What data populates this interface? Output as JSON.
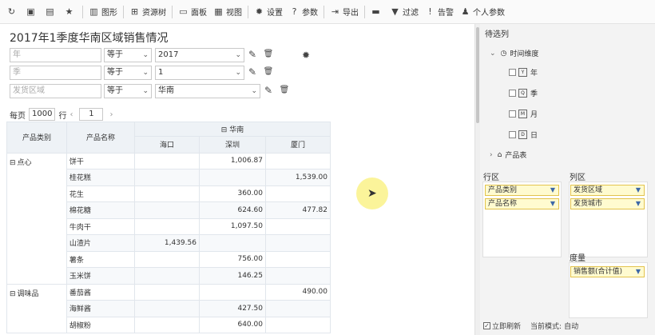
{
  "toolbar": {
    "items": [
      {
        "name": "refresh-button",
        "icon": "refresh-icon",
        "glyph": "↻",
        "label": ""
      },
      {
        "name": "save-button",
        "icon": "save-icon",
        "glyph": "▣",
        "label": ""
      },
      {
        "name": "save-as-button",
        "icon": "save-as-icon",
        "glyph": "▤",
        "label": ""
      },
      {
        "name": "favorite-button",
        "icon": "star-icon",
        "glyph": "★",
        "label": ""
      },
      {
        "name": "chart-button",
        "icon": "chart-icon",
        "glyph": "▥",
        "label": "图形"
      },
      {
        "name": "resource-tree-button",
        "icon": "resource-tree-icon",
        "glyph": "⊞",
        "label": "资源树"
      },
      {
        "name": "panel-button",
        "icon": "panel-icon",
        "glyph": "▭",
        "label": "面板"
      },
      {
        "name": "view-button",
        "icon": "view-icon",
        "glyph": "▦",
        "label": "视图"
      },
      {
        "name": "settings-button",
        "icon": "gear-icon",
        "glyph": "✹",
        "label": "设置"
      },
      {
        "name": "params-button",
        "icon": "help-icon",
        "glyph": "?",
        "label": "参数"
      },
      {
        "name": "export-button",
        "icon": "export-icon",
        "glyph": "⇥",
        "label": "导出"
      },
      {
        "name": "print-button",
        "icon": "print-icon",
        "glyph": "▬",
        "label": ""
      },
      {
        "name": "filter-button",
        "icon": "filter-icon",
        "glyph": "▼",
        "label": "过滤"
      },
      {
        "name": "alert-button",
        "icon": "alert-icon",
        "glyph": "!",
        "label": "告警"
      },
      {
        "name": "personal-params-button",
        "icon": "user-icon",
        "glyph": "♟",
        "label": "个人参数"
      }
    ]
  },
  "report": {
    "title": "2017年1季度华南区域销售情况"
  },
  "filters": [
    {
      "field": "年",
      "operator": "等于",
      "value": "2017"
    },
    {
      "field": "季",
      "operator": "等于",
      "value": "1"
    },
    {
      "field": "发货区域",
      "operator": "等于",
      "value": "华南"
    }
  ],
  "pager": {
    "per_page_label": "每页",
    "per_page_value": "1000",
    "row_label": "行",
    "prev": "‹",
    "page_value": "1",
    "next": "›"
  },
  "table": {
    "row_headers": [
      "产品类别",
      "产品名称"
    ],
    "region": "华南",
    "region_toggle": "⊟",
    "cities": [
      "海口",
      "深圳",
      "厦门"
    ],
    "groups": [
      {
        "category": "点心",
        "rows": [
          {
            "name": "饼干",
            "values": [
              "",
              "1,006.87",
              ""
            ]
          },
          {
            "name": "桂花糕",
            "values": [
              "",
              "",
              "1,539.00"
            ]
          },
          {
            "name": "花生",
            "values": [
              "",
              "360.00",
              ""
            ]
          },
          {
            "name": "棉花糖",
            "values": [
              "",
              "624.60",
              "477.82"
            ]
          },
          {
            "name": "牛肉干",
            "values": [
              "",
              "1,097.50",
              ""
            ]
          },
          {
            "name": "山渣片",
            "values": [
              "1,439.56",
              "",
              ""
            ]
          },
          {
            "name": "薯条",
            "values": [
              "",
              "756.00",
              ""
            ]
          },
          {
            "name": "玉米饼",
            "values": [
              "",
              "146.25",
              ""
            ]
          }
        ]
      },
      {
        "category": "调味品",
        "rows": [
          {
            "name": "番茄酱",
            "values": [
              "",
              "",
              "490.00"
            ]
          },
          {
            "name": "海鲜酱",
            "values": [
              "",
              "427.50",
              ""
            ]
          },
          {
            "name": "胡椒粉",
            "values": [
              "",
              "640.00",
              ""
            ]
          }
        ]
      }
    ]
  },
  "right_panel": {
    "title": "待选列",
    "time_dimension": "时间维度",
    "time_items": [
      {
        "label": "年",
        "icon_text": "Y"
      },
      {
        "label": "季",
        "icon_text": "Q"
      },
      {
        "label": "月",
        "icon_text": "M"
      },
      {
        "label": "日",
        "icon_text": "D"
      }
    ],
    "product_table": "产品表",
    "row_zone_label": "行区",
    "col_zone_label": "列区",
    "measure_zone_label": "度量",
    "row_fields": [
      "产品类别",
      "产品名称"
    ],
    "col_fields": [
      "发货区域",
      "发货城市"
    ],
    "measures": [
      "销售额(合计值)"
    ],
    "footer_refresh": "立即刷新",
    "footer_mode_label": "当前模式:",
    "footer_mode_value": "自动"
  }
}
